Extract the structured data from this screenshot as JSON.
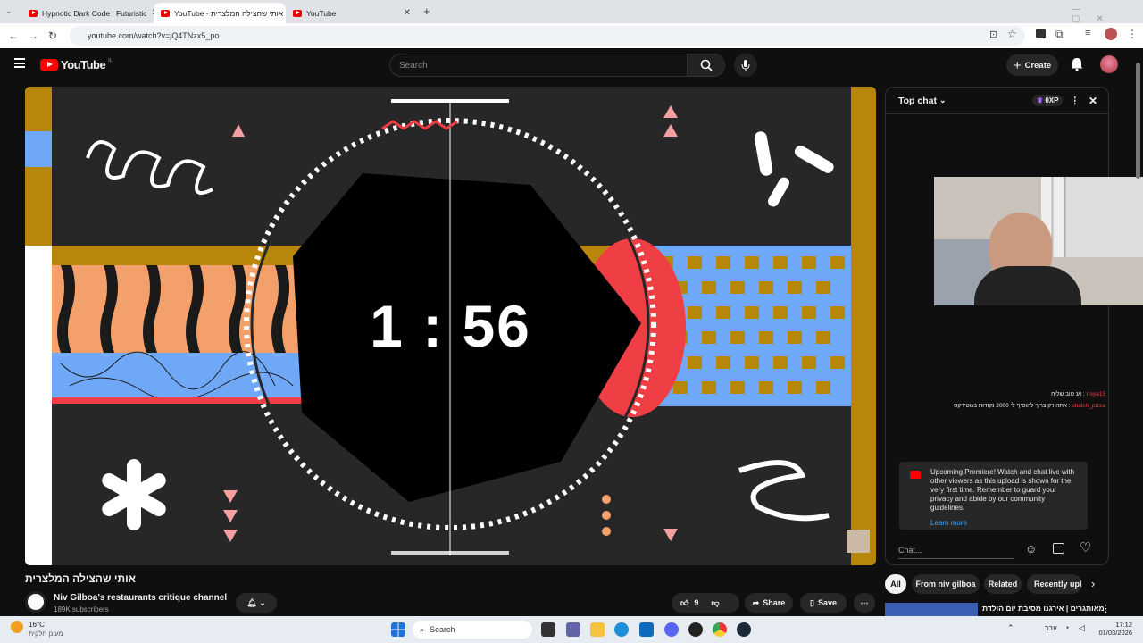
{
  "browser": {
    "tabs": [
      {
        "title": "Hypnotic Dark Code | Futuristic"
      },
      {
        "title": "הצלה אותי שהצילה המלצרית - YouTube"
      },
      {
        "title": "YouTube"
      }
    ],
    "url": "youtube.com/watch?v=jQ4TNzx5_po"
  },
  "youtube": {
    "logo": "YouTube",
    "country": "IL",
    "search_placeholder": "Search",
    "create_label": "Create"
  },
  "video": {
    "timer": "1 : 56",
    "title": "אותי שהצילה המלצרית",
    "channel": "Niv Gilboa's restaurants critique channel",
    "subscribers": "189K subscribers",
    "likes": "9",
    "share_label": "Share",
    "save_label": "Save"
  },
  "chat": {
    "mode": "Top chat",
    "xp": "0XP",
    "messages": [
      {
        "author": "noya15",
        "text": "אנ טוב שליח"
      },
      {
        "author": "shalch_pizza",
        "text": "אתה רק צריך להוסיף לי 2000 נקודות בגוטירקס"
      }
    ],
    "premiere_text": "Upcoming Premiere! Watch and chat live with other viewers as this upload is shown for the very first time. Remember to guard your privacy and abide by our community guidelines.",
    "learn_more": "Learn more",
    "input_placeholder": "Chat..."
  },
  "filters": [
    "All",
    "From niv gilboa",
    "Related",
    "Recently upl"
  ],
  "related_item": "מאותגרים | אירגנו מסיבת יום הולדת",
  "taskbar": {
    "weather_temp": "16°C",
    "weather_desc": "מעונן חלקית",
    "search_label": "Search",
    "lang": "עבר",
    "time": "17:12",
    "date": "01/03/2026"
  },
  "colors": {
    "youtube_red": "#ff0000",
    "accent_blue": "#3ea6ff"
  }
}
